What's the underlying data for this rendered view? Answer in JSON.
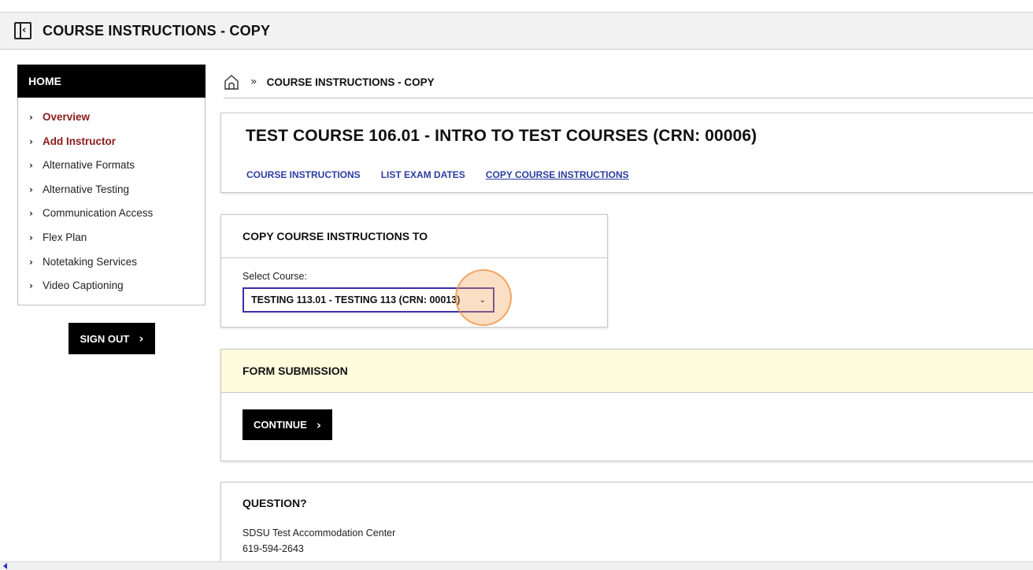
{
  "header": {
    "title": "COURSE INSTRUCTIONS - COPY",
    "collapse_glyph": "‹"
  },
  "sidebar": {
    "heading": "HOME",
    "items": [
      {
        "label": "Overview",
        "active": true
      },
      {
        "label": "Add Instructor",
        "active": true
      },
      {
        "label": "Alternative Formats",
        "active": false
      },
      {
        "label": "Alternative Testing",
        "active": false
      },
      {
        "label": "Communication Access",
        "active": false
      },
      {
        "label": "Flex Plan",
        "active": false
      },
      {
        "label": "Notetaking Services",
        "active": false
      },
      {
        "label": "Video Captioning",
        "active": false
      }
    ],
    "chevron": "›",
    "signout_label": "SIGN OUT",
    "signout_arrow": "›"
  },
  "breadcrumb": {
    "separator": "»",
    "current": "COURSE INSTRUCTIONS - COPY"
  },
  "course": {
    "title": "TEST COURSE 106.01 - INTRO TO TEST COURSES (CRN: 00006)",
    "tabs": [
      {
        "label": "COURSE INSTRUCTIONS"
      },
      {
        "label": "LIST EXAM DATES"
      },
      {
        "label": "COPY COURSE INSTRUCTIONS"
      }
    ]
  },
  "copy": {
    "heading": "COPY COURSE INSTRUCTIONS TO",
    "select_label": "Select Course:",
    "selected_value": "TESTING 113.01 - TESTING 113 (CRN: 00013)",
    "select_chevron": "⌄"
  },
  "form": {
    "heading": "FORM SUBMISSION",
    "continue_label": "CONTINUE",
    "continue_arrow": "›"
  },
  "question": {
    "heading": "QUESTION?",
    "org": "SDSU Test Accommodation Center",
    "phone": "619-594-2643"
  },
  "colors": {
    "active_nav": "#8b1a1a",
    "link": "#2c3ea0",
    "select_border": "#3a30a8",
    "form_header_bg": "#fdfcdc",
    "click_highlight": "#f4a259"
  }
}
